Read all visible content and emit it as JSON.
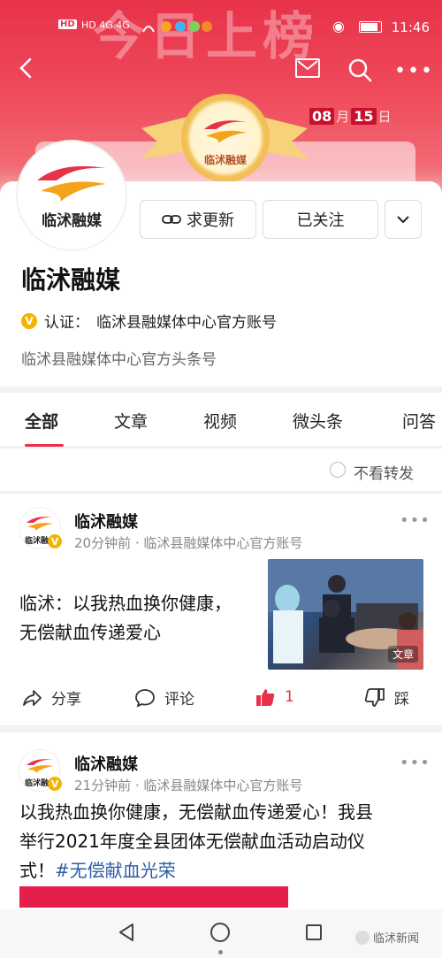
{
  "status_bar": {
    "time": "11:46",
    "left_icons": "HD 4G 4G"
  },
  "banner": {
    "big_title": "今日上榜",
    "date_month": "08",
    "date_month_unit": "月",
    "date_day": "15",
    "date_day_unit": "日",
    "medal_text": "临沭融媒"
  },
  "profile": {
    "avatar_text": "临沭融媒",
    "update_button": "求更新",
    "follow_button": "已关注",
    "name": "临沭融媒",
    "verify_label": "认证：",
    "verify_text": "临沭县融媒体中心官方账号",
    "description": "临沭县融媒体中心官方头条号"
  },
  "tabs": [
    "全部",
    "文章",
    "视频",
    "微头条",
    "问答"
  ],
  "filter": {
    "label": "不看转发"
  },
  "posts": [
    {
      "author": "临沭融媒",
      "avatar_text": "临沭融",
      "meta": "20分钟前 · 临沭县融媒体中心官方账号",
      "title_line1": "临沭：以我热血换你健康，",
      "title_line2": "无偿献血传递爱心",
      "thumb_tag": "文章",
      "share": "分享",
      "comment": "评论",
      "like_count": "1",
      "dislike": "踩"
    },
    {
      "author": "临沭融媒",
      "avatar_text": "临沭融",
      "meta": "21分钟前 · 临沭县融媒体中心官方账号",
      "text_line1": "以我热血换你健康，无偿献血传递爱心！我县",
      "text_line2": "举行2021年度全县团体无偿献血活动启动仪",
      "text_line3_prefix": "式！",
      "hashtag": "#无偿献血光荣"
    }
  ],
  "watermark": "临沭新闻",
  "colors": {
    "brand_red": "#e8324a",
    "hashtag_blue": "#2c5da8",
    "verify_gold": "#f3b400"
  }
}
